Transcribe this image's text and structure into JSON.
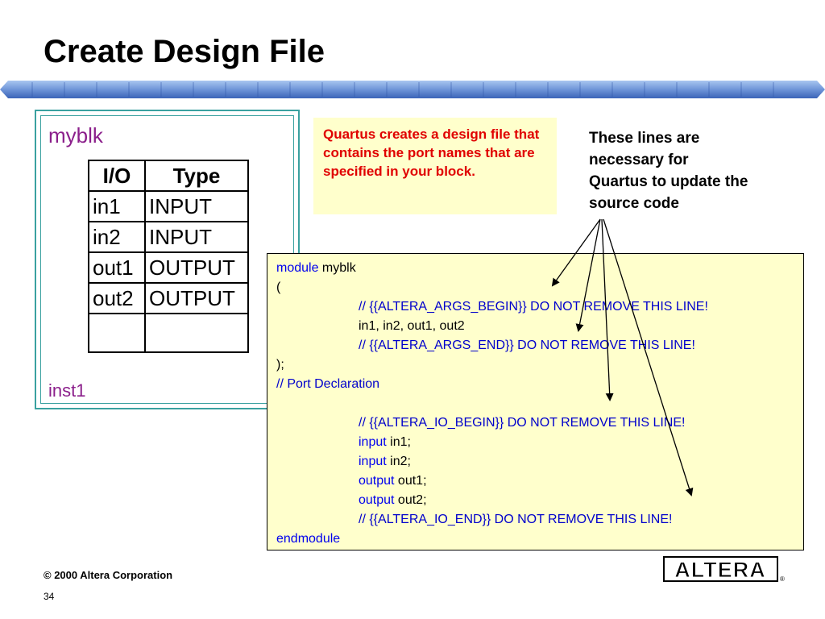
{
  "slide": {
    "title": "Create Design File",
    "footer_copyright": "© 2000 Altera Corporation",
    "page_number": "34",
    "logo_text": "ALTERA"
  },
  "block": {
    "name": "myblk",
    "instance": "inst1",
    "table": {
      "headers": [
        "I/O",
        "Type"
      ],
      "rows": [
        [
          "in1",
          "INPUT"
        ],
        [
          "in2",
          "INPUT"
        ],
        [
          "out1",
          "OUTPUT"
        ],
        [
          "out2",
          "OUTPUT"
        ],
        [
          "",
          ""
        ]
      ]
    }
  },
  "note": {
    "text": "Quartus creates a design file that contains the port names that are specified in your block."
  },
  "callout": {
    "text": "These lines are necessary for Quartus to update the source code"
  },
  "code": {
    "l1_kw": "module",
    "l1_rest": " myblk",
    "l2": "(",
    "l3": "// {{ALTERA_ARGS_BEGIN}} DO NOT REMOVE THIS LINE!",
    "l4": "in1, in2, out1, out2",
    "l5": "// {{ALTERA_ARGS_END}} DO NOT REMOVE THIS LINE!",
    "l6": ");",
    "l7": "// Port Declaration",
    "l9": "// {{ALTERA_IO_BEGIN}} DO NOT REMOVE THIS LINE!",
    "l10_kw": "input",
    "l10_rest": " in1;",
    "l11_kw": "input",
    "l11_rest": " in2;",
    "l12_kw": "output",
    "l12_rest": " out1;",
    "l13_kw": "output",
    "l13_rest": " out2;",
    "l14": "// {{ALTERA_IO_END}} DO NOT REMOVE THIS LINE!",
    "l15": "endmodule"
  },
  "colors": {
    "banner": "#5a86d0",
    "block_border": "#3aa1a0",
    "block_text": "#8b1f8b",
    "note_bg": "#ffffcc",
    "note_text": "#e00000",
    "code_keyword": "#0000ee"
  }
}
